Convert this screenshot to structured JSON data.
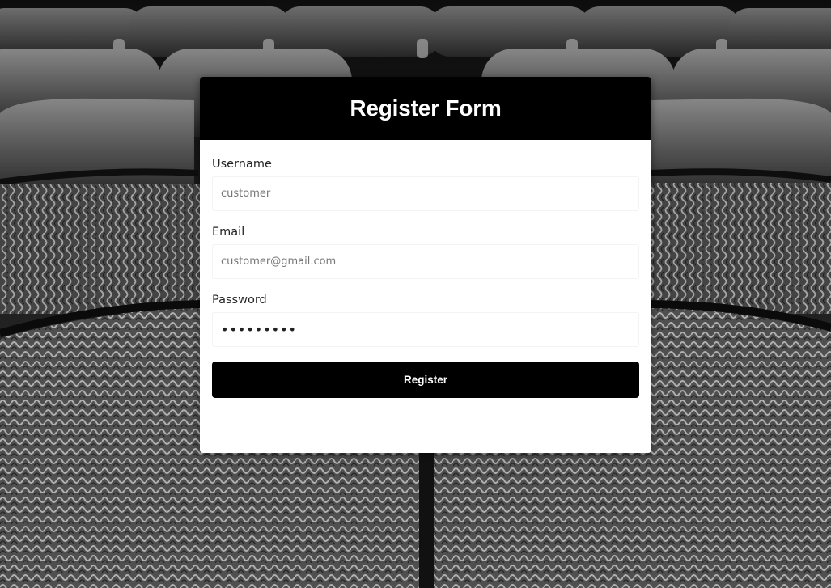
{
  "form": {
    "title": "Register Form",
    "username_label": "Username",
    "username_value": "customer",
    "email_label": "Email",
    "email_value": "customer@gmail.com",
    "password_label": "Password",
    "password_value": "customer1",
    "submit_label": "Register"
  },
  "colors": {
    "header_bg": "#000000",
    "button_bg": "#000000",
    "card_bg": "#ffffff",
    "background_tone": "grayscale"
  },
  "background": {
    "image": "theater-seats-photo"
  }
}
